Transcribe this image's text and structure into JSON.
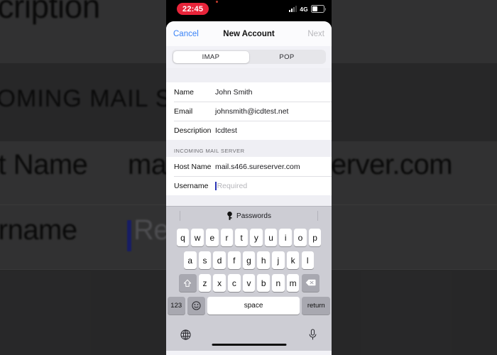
{
  "background": {
    "description": "blurred zoomed duplicate of the iOS new-account screen behind the phone",
    "lines": [
      {
        "text": "scription",
        "value": "Icdtest"
      },
      {
        "text": "COMING MAIL SERVER"
      },
      {
        "text": "st Name",
        "value": "mail.s466.sureserver.com"
      },
      {
        "text": "ername",
        "value": "Required"
      }
    ],
    "fragments": {
      "description_label": "scription",
      "description_value": "Icd",
      "section_header": "COMING MAIL SERVER",
      "host_label": "st Name",
      "host_value_left": "ma",
      "host_value_right": "erver.com",
      "username_label": "ername",
      "username_placeholder": "Req"
    }
  },
  "status_bar": {
    "recording_time": "22:45",
    "network": "4G",
    "signal_icon": "cellular-signal-icon",
    "battery_icon": "battery-icon"
  },
  "nav_bar": {
    "cancel_label": "Cancel",
    "title": "New Account",
    "next_label": "Next",
    "next_disabled": true,
    "cancel_color": "#3a83f7",
    "next_color": "#b9b9bd"
  },
  "segmented_control": {
    "options": [
      "IMAP",
      "POP"
    ],
    "selected": "IMAP"
  },
  "account_section": {
    "rows": [
      {
        "label": "Name",
        "value": "John Smith",
        "placeholder": false
      },
      {
        "label": "Email",
        "value": "johnsmith@icdtest.net",
        "placeholder": false
      },
      {
        "label": "Description",
        "value": "Icdtest",
        "placeholder": false
      }
    ]
  },
  "incoming_section": {
    "header": "INCOMING MAIL SERVER",
    "rows": [
      {
        "label": "Host Name",
        "value": "mail.s466.sureserver.com",
        "placeholder": false
      },
      {
        "label": "Username",
        "value": "Required",
        "placeholder": true,
        "focused": true
      }
    ]
  },
  "accessory_bar": {
    "label": "Passwords",
    "icon": "key-icon"
  },
  "keyboard": {
    "row1": [
      "q",
      "w",
      "e",
      "r",
      "t",
      "y",
      "u",
      "i",
      "o",
      "p"
    ],
    "row2": [
      "a",
      "s",
      "d",
      "f",
      "g",
      "h",
      "j",
      "k",
      "l"
    ],
    "row3": [
      "z",
      "x",
      "c",
      "v",
      "b",
      "n",
      "m"
    ],
    "shift_icon": "shift-icon",
    "backspace_icon": "backspace-icon",
    "numbers_label": "123",
    "emoji_icon": "emoji-icon",
    "space_label": "space",
    "return_label": "return",
    "globe_icon": "globe-icon",
    "dictation_icon": "microphone-icon"
  },
  "colors": {
    "accent_blue": "#3a83f7",
    "record_red": "#e8243a",
    "caret_blue": "#2b35b6",
    "keyboard_bg": "#cdcdd4",
    "sheet_bg": "#f2f2f7"
  }
}
